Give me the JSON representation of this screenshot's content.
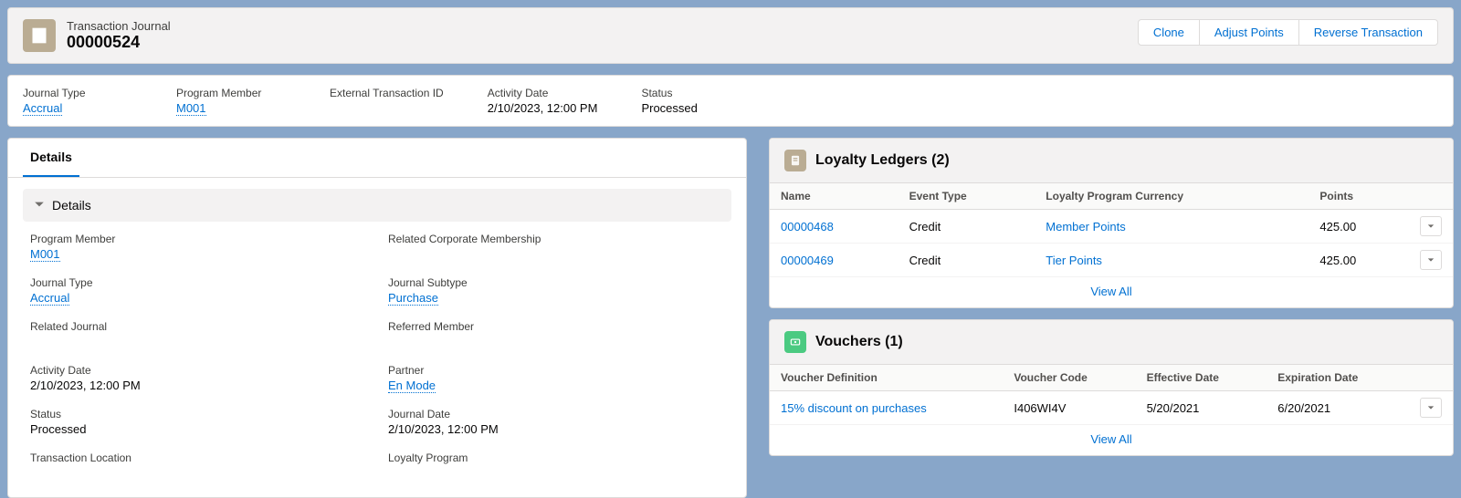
{
  "header": {
    "object_label": "Transaction Journal",
    "record_name": "00000524",
    "actions": {
      "clone": "Clone",
      "adjust": "Adjust Points",
      "reverse": "Reverse Transaction"
    }
  },
  "highlights": {
    "journal_type": {
      "label": "Journal Type",
      "value": "Accrual"
    },
    "program_member": {
      "label": "Program Member",
      "value": "M001"
    },
    "external_txn": {
      "label": "External Transaction ID",
      "value": ""
    },
    "activity_date": {
      "label": "Activity Date",
      "value": "2/10/2023, 12:00 PM"
    },
    "status": {
      "label": "Status",
      "value": "Processed"
    }
  },
  "tabs": {
    "details": "Details"
  },
  "details": {
    "section_title": "Details",
    "program_member": {
      "label": "Program Member",
      "value": "M001"
    },
    "related_corp": {
      "label": "Related Corporate Membership",
      "value": ""
    },
    "journal_type": {
      "label": "Journal Type",
      "value": "Accrual"
    },
    "journal_subtype": {
      "label": "Journal Subtype",
      "value": "Purchase"
    },
    "related_journal": {
      "label": "Related Journal",
      "value": ""
    },
    "referred_member": {
      "label": "Referred Member",
      "value": ""
    },
    "activity_date": {
      "label": "Activity Date",
      "value": "2/10/2023, 12:00 PM"
    },
    "partner": {
      "label": "Partner",
      "value": "En Mode"
    },
    "status": {
      "label": "Status",
      "value": "Processed"
    },
    "journal_date": {
      "label": "Journal Date",
      "value": "2/10/2023, 12:00 PM"
    },
    "txn_location": {
      "label": "Transaction Location",
      "value": ""
    },
    "loyalty_program": {
      "label": "Loyalty Program",
      "value": ""
    }
  },
  "ledgers": {
    "title": "Loyalty Ledgers (2)",
    "columns": {
      "name": "Name",
      "event_type": "Event Type",
      "currency": "Loyalty Program Currency",
      "points": "Points"
    },
    "rows": [
      {
        "name": "00000468",
        "event_type": "Credit",
        "currency": "Member Points",
        "points": "425.00"
      },
      {
        "name": "00000469",
        "event_type": "Credit",
        "currency": "Tier Points",
        "points": "425.00"
      }
    ],
    "view_all": "View All"
  },
  "vouchers": {
    "title": "Vouchers (1)",
    "columns": {
      "def": "Voucher Definition",
      "code": "Voucher Code",
      "eff": "Effective Date",
      "exp": "Expiration Date"
    },
    "rows": [
      {
        "def": "15% discount on purchases",
        "code": "I406WI4V",
        "eff": "5/20/2021",
        "exp": "6/20/2021"
      }
    ],
    "view_all": "View All"
  }
}
